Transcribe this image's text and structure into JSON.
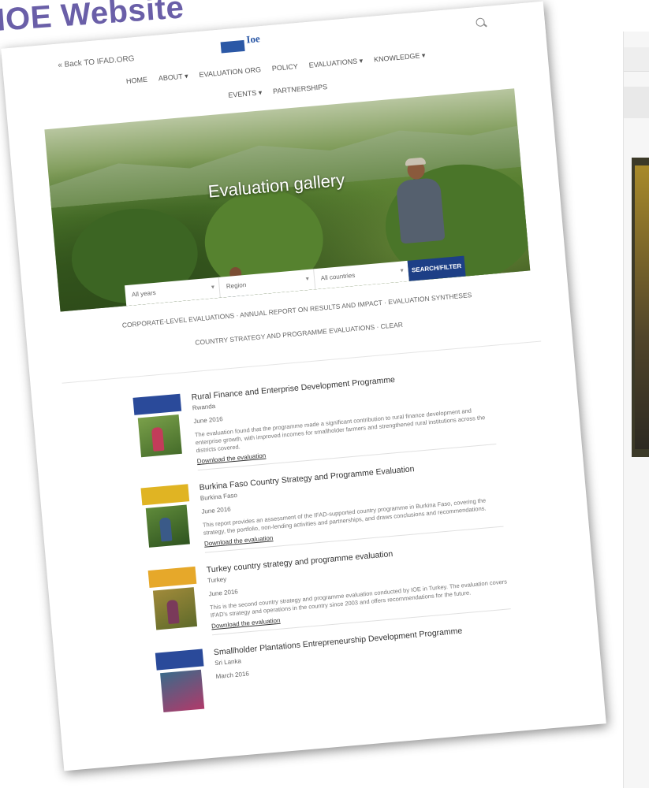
{
  "slide": {
    "title": "IOE Website"
  },
  "site": {
    "back_link": "« Back TO IFAD.ORG",
    "logo_text": "Ioe",
    "nav": [
      "HOME",
      "ABOUT ▾",
      "EVALUATION ORG",
      "POLICY",
      "EVALUATIONS ▾",
      "KNOWLEDGE ▾"
    ],
    "nav2": [
      "EVENTS ▾",
      "PARTNERSHIPS"
    ]
  },
  "hero": {
    "title": "Evaluation gallery",
    "filters": [
      "All years",
      "Region",
      "All countries"
    ],
    "filter_button": "SEARCH/FILTER"
  },
  "subnav": {
    "row1": "CORPORATE-LEVEL EVALUATIONS · ANNUAL REPORT ON RESULTS AND IMPACT · EVALUATION SYNTHESES",
    "row2": "COUNTRY STRATEGY AND PROGRAMME EVALUATIONS · CLEAR"
  },
  "results": [
    {
      "title": "Rural Finance and Enterprise Development Programme",
      "country": "Rwanda",
      "date": "June 2016",
      "desc": "The evaluation found that the programme made a significant contribution to rural finance development and enterprise growth, with improved incomes for smallholder farmers and strengthened rural institutions across the districts covered.",
      "link": "Download the evaluation",
      "color": "#2a4a9a"
    },
    {
      "title": "Burkina Faso Country Strategy and Programme Evaluation",
      "country": "Burkina Faso",
      "date": "June 2016",
      "desc": "This report provides an assessment of the IFAD-supported country programme in Burkina Faso, covering the strategy, the portfolio, non-lending activities and partnerships, and draws conclusions and recommendations.",
      "link": "Download the evaluation",
      "color": "#e0b423"
    },
    {
      "title": "Turkey country strategy and programme evaluation",
      "country": "Turkey",
      "date": "June 2016",
      "desc": "This is the second country strategy and programme evaluation conducted by IOE in Turkey. The evaluation covers IFAD's strategy and operations in the country since 2003 and offers recommendations for the future.",
      "link": "Download the evaluation",
      "color": "#e6a82a"
    },
    {
      "title": "Smallholder Plantations Entrepreneurship Development Programme",
      "country": "Sri Lanka",
      "date": "March 2016",
      "desc": "",
      "link": "",
      "color": "#2a4a9a"
    }
  ]
}
